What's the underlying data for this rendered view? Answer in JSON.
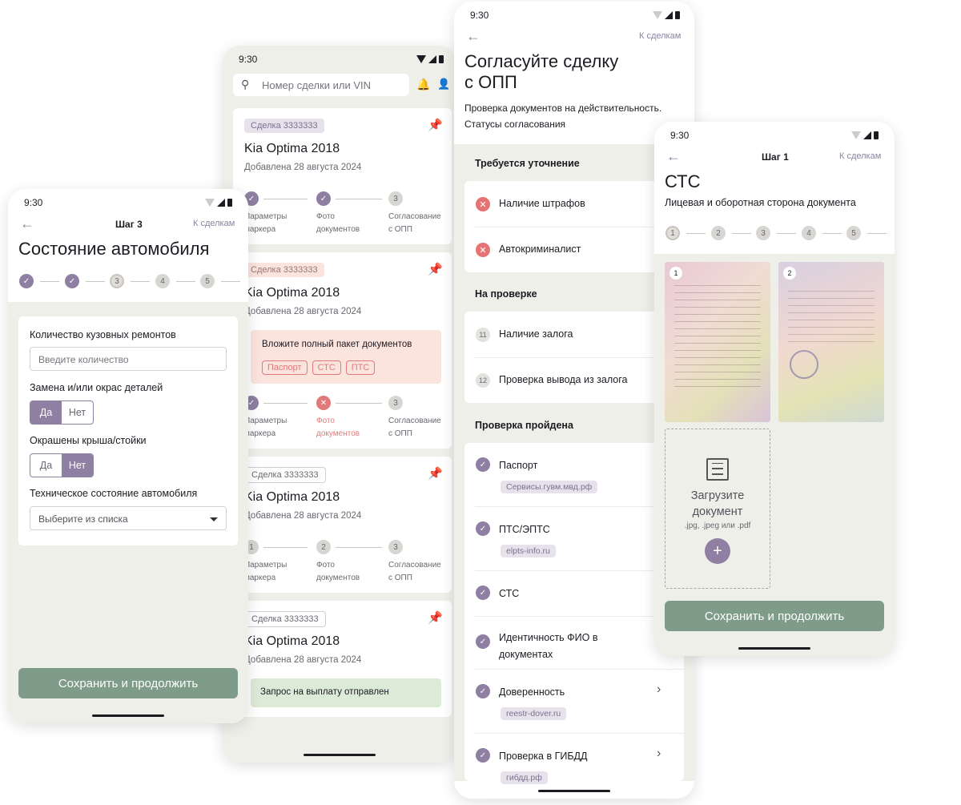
{
  "status_time": "9:30",
  "phone1": {
    "step": "Шаг 3",
    "to_deals": "К сделкам",
    "title": "Состояние автомобиля",
    "steps": [
      "✓",
      "✓",
      "3",
      "4",
      "5"
    ],
    "q1_label": "Количество кузовных ремонтов",
    "q1_placeholder": "Введите количество",
    "q2_label": "Замена и/или окрас деталей",
    "q3_label": "Окрашены крыша/стойки",
    "yes": "Да",
    "no": "Нет",
    "q4_label": "Техническое состояние автомобиля",
    "q4_placeholder": "Выберите из списка",
    "save": "Сохранить и продолжить"
  },
  "phone2": {
    "search_placeholder": "Номер сделки или VIN",
    "deal_tag": "Сделка 3333333",
    "car": "Kia Optima 2018",
    "added": "Добавлена 28 августа 2024",
    "step1a": "Параметры",
    "step1b": "маркера",
    "step2a": "Фото",
    "step2b": "документов",
    "step3a": "Согласование",
    "step3b": "с ОПП",
    "docs_request": "Вложите полный пакет документов",
    "doc_chips": [
      "Паспорт",
      "СТС",
      "ПТС"
    ],
    "payout": "Запрос на выплату отправлен",
    "n1": "1",
    "n2": "2",
    "n3": "3"
  },
  "phone3": {
    "to_deals": "К сделкам",
    "title1": "Согласуйте сделку",
    "title2": "с ОПП",
    "subtitle1": "Проверка документов на действительность.",
    "subtitle2": "Статусы согласования",
    "sec1": "Требуется уточнение",
    "r1": "Наличие штрафов",
    "r2": "Автокриминалист",
    "sec2": "На проверке",
    "r3n": "11",
    "r3": "Наличие залога",
    "r4n": "12",
    "r4": "Проверка вывода из залога",
    "sec3": "Проверка пройдена",
    "r5": "Паспорт",
    "r5s": "Сервисы.гувм.мвд.рф",
    "r6": "ПТС/ЭПТС",
    "r6s": "elpts-info.ru",
    "r7": "СТС",
    "r8a": "Идентичность ФИО в",
    "r8b": "документах",
    "r9": "Доверенность",
    "r9s": "reestr-dover.ru",
    "r10": "Проверка в ГИБДД",
    "r10s": "гибдд.рф"
  },
  "phone4": {
    "step": "Шаг 1",
    "to_deals": "К сделкам",
    "title": "СТС",
    "subtitle": "Лицевая и оборотная сторона документа",
    "steps": [
      "1",
      "2",
      "3",
      "4",
      "5"
    ],
    "img1": "1",
    "img2": "2",
    "upload1": "Загрузите",
    "upload2": "документ",
    "formats": ".jpg, .jpeg или .pdf",
    "save": "Сохранить и продолжить"
  }
}
